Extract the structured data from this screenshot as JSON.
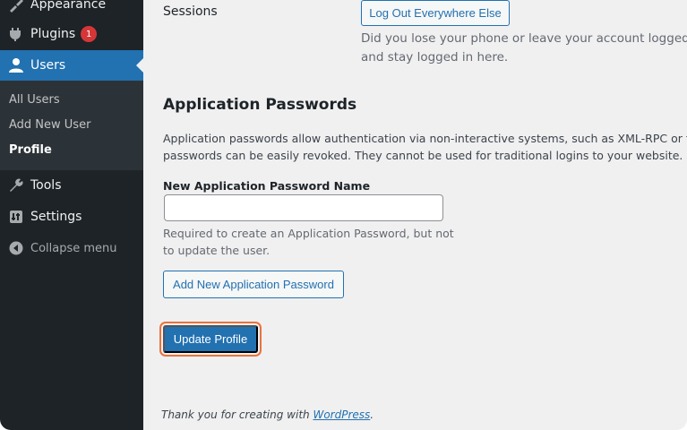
{
  "sidebar": {
    "menu": [
      {
        "label": "Appearance",
        "icon": "paintbrush-icon"
      },
      {
        "label": "Plugins",
        "icon": "plugin-icon",
        "badge": "1"
      },
      {
        "label": "Users",
        "icon": "user-icon",
        "active": true
      },
      {
        "label": "Tools",
        "icon": "wrench-icon"
      },
      {
        "label": "Settings",
        "icon": "settings-icon"
      }
    ],
    "submenu": [
      "All Users",
      "Add New User",
      "Profile"
    ],
    "collapse_label": "Collapse menu"
  },
  "sessions": {
    "label": "Sessions",
    "button": "Log Out Everywhere Else",
    "desc_line1": "Did you lose your phone or leave your account logged in a",
    "desc_line2": "and stay logged in here."
  },
  "app_passwords": {
    "title": "Application Passwords",
    "desc_line1": "Application passwords allow authentication via non-interactive systems, such as XML-RPC or the REST",
    "desc_line2": "passwords can be easily revoked. They cannot be used for traditional logins to your website.",
    "field_label": "New Application Password Name",
    "input_value": "",
    "help_line1": "Required to create an Application Password, but not",
    "help_line2": "to update the user.",
    "add_button": "Add New Application Password"
  },
  "update_button": "Update Profile",
  "footer": {
    "prefix": "Thank you for creating with ",
    "link": "WordPress",
    "suffix": "."
  },
  "colors": {
    "sidebar_bg": "#1d2327",
    "accent": "#2271b1",
    "badge": "#d63638",
    "focus_ring": "#e9733e"
  }
}
